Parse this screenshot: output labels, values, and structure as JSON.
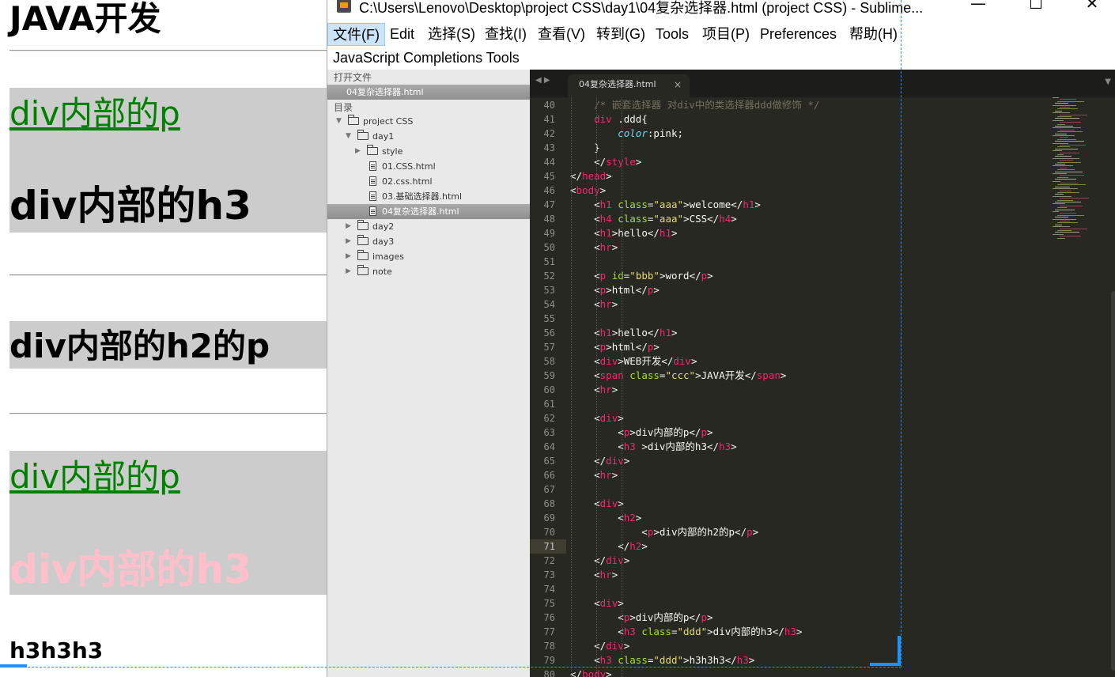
{
  "browser": {
    "h1_java": "JAVA开发",
    "link1": "div内部的p",
    "h3_1": "div内部的h3",
    "h2p": "div内部的h2的p",
    "link2": "div内部的p",
    "h3_pink": "div内部的h3",
    "h3h3h3": "h3h3h3",
    "colors": {
      "link": "#008000",
      "pink": "#ffc0cb",
      "div_bg": "#cccccc"
    }
  },
  "window": {
    "title": "C:\\Users\\Lenovo\\Desktop\\project CSS\\day1\\04复杂选择器.html (project CSS) - Sublime...",
    "minimize": "—",
    "maximize": "☐",
    "close": "✕"
  },
  "menu": {
    "items": [
      "文件(F)",
      "Edit",
      "选择(S)",
      "查找(I)",
      "查看(V)",
      "转到(G)",
      "Tools",
      "项目(P)",
      "Preferences",
      "帮助(H)"
    ],
    "row2": "JavaScript Completions Tools"
  },
  "sidebar": {
    "open_files_header": "打开文件",
    "open_file": "04复杂选择器.html",
    "folders_header": "目录",
    "tree": [
      {
        "label": "project CSS",
        "type": "folder",
        "expanded": true
      },
      {
        "label": "day1",
        "type": "folder",
        "expanded": true
      },
      {
        "label": "style",
        "type": "folder",
        "expanded": false
      },
      {
        "label": "01.CSS.html",
        "type": "file"
      },
      {
        "label": "02.css.html",
        "type": "file"
      },
      {
        "label": "03.基础选择器.html",
        "type": "file"
      },
      {
        "label": "04复杂选择器.html",
        "type": "file",
        "selected": true
      },
      {
        "label": "day2",
        "type": "folder",
        "expanded": false
      },
      {
        "label": "day3",
        "type": "folder",
        "expanded": false
      },
      {
        "label": "images",
        "type": "folder",
        "expanded": false
      },
      {
        "label": "note",
        "type": "folder",
        "expanded": false
      }
    ]
  },
  "editor": {
    "tab_label": "04复杂选择器.html",
    "tab_close": "×",
    "current_line": 71,
    "lines": [
      {
        "n": 40,
        "t": "    /* 嵌套选择器 对div中的类选择器ddd做修饰 */"
      },
      {
        "n": 41,
        "t": "    div .ddd{"
      },
      {
        "n": 42,
        "t": "        color:pink;"
      },
      {
        "n": 43,
        "t": "    }"
      },
      {
        "n": 44,
        "t": "    </style>"
      },
      {
        "n": 45,
        "t": "</head>"
      },
      {
        "n": 46,
        "t": "<body>"
      },
      {
        "n": 47,
        "t": "    <h1 class=\"aaa\">welcome</h1>"
      },
      {
        "n": 48,
        "t": "    <h4 class=\"aaa\">CSS</h4>"
      },
      {
        "n": 49,
        "t": "    <h1>hello</h1>"
      },
      {
        "n": 50,
        "t": "    <hr>"
      },
      {
        "n": 51,
        "t": ""
      },
      {
        "n": 52,
        "t": "    <p id=\"bbb\">word</p>"
      },
      {
        "n": 53,
        "t": "    <p>html</p>"
      },
      {
        "n": 54,
        "t": "    <hr>"
      },
      {
        "n": 55,
        "t": ""
      },
      {
        "n": 56,
        "t": "    <h1>hello</h1>"
      },
      {
        "n": 57,
        "t": "    <p>html</p>"
      },
      {
        "n": 58,
        "t": "    <div>WEB开发</div>"
      },
      {
        "n": 59,
        "t": "    <span class=\"ccc\">JAVA开发</span>"
      },
      {
        "n": 60,
        "t": "    <hr>"
      },
      {
        "n": 61,
        "t": ""
      },
      {
        "n": 62,
        "t": "    <div>"
      },
      {
        "n": 63,
        "t": "        <p>div内部的p</p>"
      },
      {
        "n": 64,
        "t": "        <h3 >div内部的h3</h3>"
      },
      {
        "n": 65,
        "t": "    </div>"
      },
      {
        "n": 66,
        "t": "    <hr>"
      },
      {
        "n": 67,
        "t": ""
      },
      {
        "n": 68,
        "t": "    <div>"
      },
      {
        "n": 69,
        "t": "        <h2>"
      },
      {
        "n": 70,
        "t": "            <p>div内部的h2的p</p>"
      },
      {
        "n": 71,
        "t": "        </h2>"
      },
      {
        "n": 72,
        "t": "    </div>"
      },
      {
        "n": 73,
        "t": "    <hr>"
      },
      {
        "n": 74,
        "t": ""
      },
      {
        "n": 75,
        "t": "    <div>"
      },
      {
        "n": 76,
        "t": "        <p>div内部的p</p>"
      },
      {
        "n": 77,
        "t": "        <h3 class=\"ddd\">div内部的h3</h3>"
      },
      {
        "n": 78,
        "t": "    </div>"
      },
      {
        "n": 79,
        "t": "    <h3 class=\"ddd\">h3h3h3</h3>"
      },
      {
        "n": 80,
        "t": "</body>"
      }
    ],
    "syntax_colors": {
      "tag": "#f92672",
      "attr": "#a6e22e",
      "string": "#e6db74",
      "comment": "#75715e",
      "property": "#66d9ef",
      "text": "#f8f8f2"
    }
  }
}
